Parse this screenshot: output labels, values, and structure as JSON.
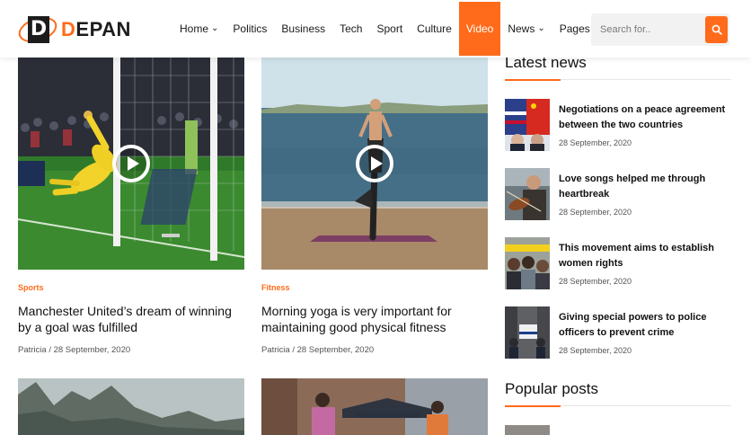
{
  "brand": {
    "logo_letter": "D",
    "first_letter": "D",
    "rest": "EPAN"
  },
  "nav": [
    {
      "label": "Home",
      "dropdown": true,
      "active": false
    },
    {
      "label": "Politics",
      "dropdown": false,
      "active": false
    },
    {
      "label": "Business",
      "dropdown": false,
      "active": false
    },
    {
      "label": "Tech",
      "dropdown": false,
      "active": false
    },
    {
      "label": "Sport",
      "dropdown": false,
      "active": false
    },
    {
      "label": "Culture",
      "dropdown": false,
      "active": false
    },
    {
      "label": "Video",
      "dropdown": false,
      "active": true
    },
    {
      "label": "News",
      "dropdown": true,
      "active": false
    },
    {
      "label": "Pages",
      "dropdown": true,
      "active": false
    }
  ],
  "search": {
    "placeholder": "Search for..",
    "icon": "search-icon"
  },
  "posts": [
    {
      "category": "Sports",
      "title": "Manchester United’s dream of winning by a goal was fulfilled",
      "meta": "Patricia / 28 September, 2020",
      "has_play": true
    },
    {
      "category": "Fitness",
      "title": "Morning yoga is very important for maintaining good physical fitness",
      "meta": "Patricia / 28 September, 2020",
      "has_play": true
    }
  ],
  "latest": {
    "heading": "Latest news",
    "items": [
      {
        "title": "Negotiations on a peace agreement between the two countries",
        "date": "28 September, 2020"
      },
      {
        "title": "Love songs helped me through heartbreak",
        "date": "28 September, 2020"
      },
      {
        "title": "This movement aims to establish women rights",
        "date": "28 September, 2020"
      },
      {
        "title": "Giving special powers to police officers to prevent crime",
        "date": "28 September, 2020"
      }
    ]
  },
  "popular": {
    "heading": "Popular posts"
  },
  "colors": {
    "accent": "#ff6b1a",
    "text": "#111111"
  }
}
